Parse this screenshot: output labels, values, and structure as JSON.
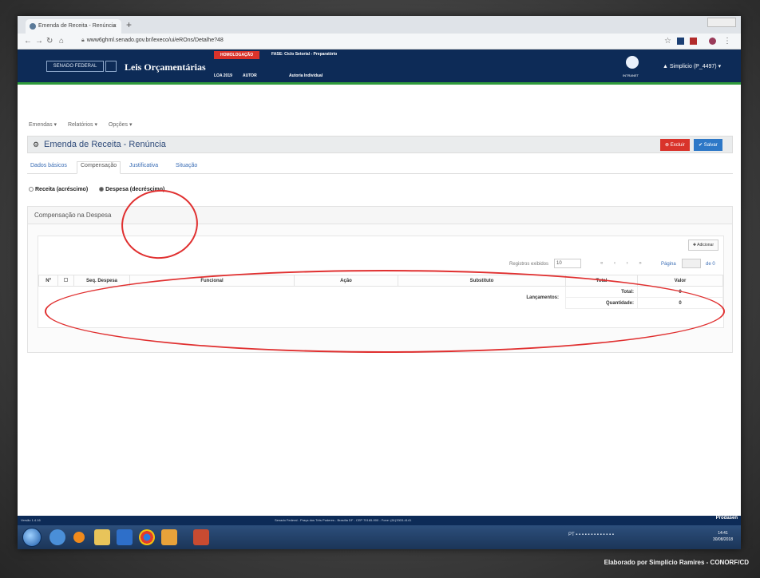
{
  "browser": {
    "tab_title": "Emenda de Receita - Renúncia",
    "tab_close": "×",
    "new_tab": "+",
    "url": "www6ghml.senado.gov.br/lexeco/ui/eROns/Detalhe?48"
  },
  "header": {
    "sf_button": "SENADO FEDERAL",
    "app_title": "Leis Orçamentárias",
    "homologacao": "HOMOLOGAÇÃO",
    "fase": "FASE: Ciclo Setorial - Preparatório",
    "loa": "LOA 2019",
    "autor": "AUTOR",
    "autoria": "Autoria Individual",
    "intranet": "INTRANET",
    "user": "Simplicio (P_4497)"
  },
  "menu": [
    "Emendas ▾",
    "Relatórios ▾",
    "Opções ▾"
  ],
  "page": {
    "title": "Emenda de Receita - Renúncia",
    "excluir": "Excluir",
    "salvar": "Salvar"
  },
  "tabs": [
    "Dados básicos",
    "Compensação",
    "Justificativa",
    "Situação"
  ],
  "radios": {
    "receita": "Receita (acréscimo)",
    "despesa": "Despesa (decréscimo)"
  },
  "panel": {
    "title": "Compensação na Despesa",
    "add": "Adicionar",
    "registros": "Registros exibidos",
    "registros_value": "10",
    "pagina": "Página",
    "pagina_de": "de 0"
  },
  "table": {
    "headers": [
      "Nº",
      "Seq. Despesa",
      "Funcional",
      "Ação",
      "Substituto",
      "Total",
      "Valor"
    ],
    "lancamentos": "Lançamentos:",
    "total_label": "Total:",
    "total_value": "0",
    "quantidade_label": "Quantidade:",
    "quantidade_value": "0"
  },
  "status": {
    "version": "Versão 1.4.16",
    "address": "Senado Federal - Praça dos Três Poderes - Brasília DF - CEP 70165-900 - Fone: (61)3303-4141",
    "prodasen": "Prodasen"
  },
  "clock": {
    "time": "14:41",
    "date": "30/08/2018"
  },
  "caption": "Elaborado por Simplício Ramires - CONORF/CD",
  "colors": {
    "header": "#0d2b57",
    "excluir": "#d9332b",
    "salvar": "#2e78c7",
    "annotation": "#e03030"
  }
}
